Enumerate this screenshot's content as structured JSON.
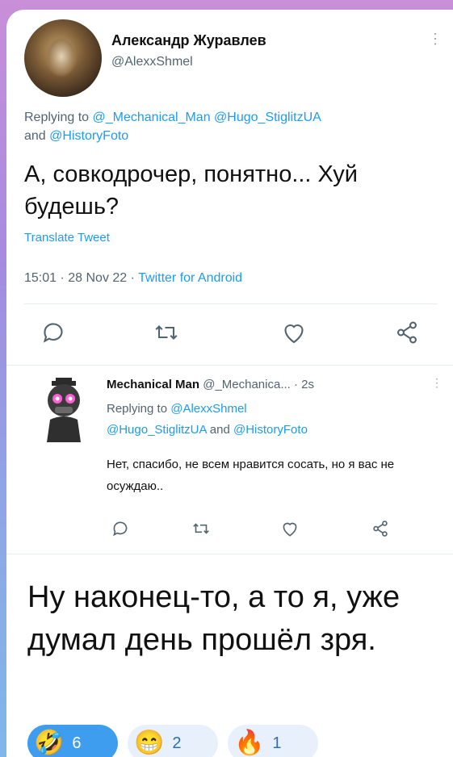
{
  "main_tweet": {
    "author_name": "Александр Журавлев",
    "handle": "@AlexxShmel",
    "more": "⋮",
    "reply_prefix": "Replying to ",
    "reply_to_1": "@_Mechanical_Man",
    "reply_to_2": "@Hugo_StiglitzUA",
    "reply_and": " and ",
    "reply_to_3": "@HistoryFoto",
    "text": "А, совкодрочер, понятно... Хуй будешь?",
    "translate": "Translate Tweet",
    "meta": "15:01 · 28 Nov 22 · ",
    "client": "Twitter for Android"
  },
  "reply_tweet": {
    "author_name": "Mechanical Man",
    "handle_time": " @_Mechanica... · 2s",
    "more": "⋮",
    "reply_prefix": "Replying to ",
    "reply_to_1": "@AlexxShmel",
    "reply_to_2": "@Hugo_StiglitzUA",
    "reply_and": " and ",
    "reply_to_3": "@HistoryFoto",
    "text": "Нет, спасибо, не всем нравится сосать, но я вас не осуждаю.."
  },
  "caption": "Ну наконец-то, а то я, уже думал день прошёл зря.",
  "reactions": [
    {
      "emoji": "🤣",
      "count": "6",
      "active": true
    },
    {
      "emoji": "😁",
      "count": "2",
      "active": false
    },
    {
      "emoji": "🔥",
      "count": "1",
      "active": false
    }
  ],
  "colors": {
    "accent": "#1d9bf0",
    "secondary_text": "#536471",
    "reaction_active": "#3f9df0"
  },
  "icons": [
    "reply-icon",
    "retweet-icon",
    "like-icon",
    "share-icon"
  ]
}
